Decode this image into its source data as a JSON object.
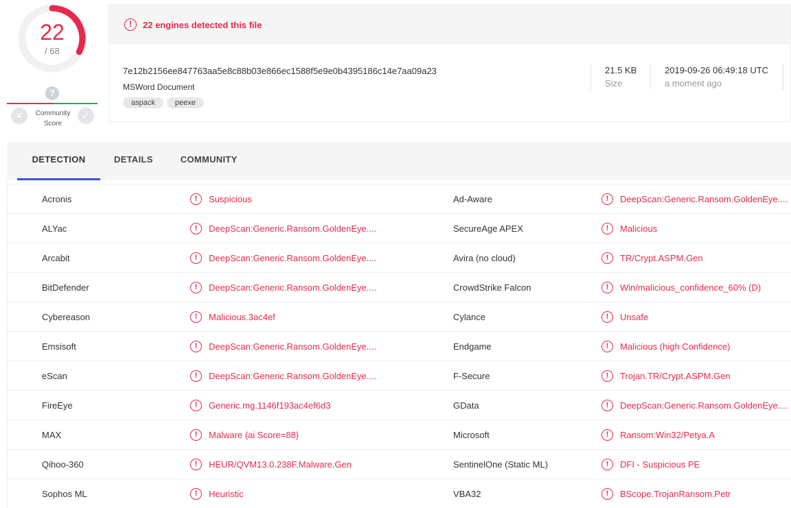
{
  "score": {
    "detected": "22",
    "total": "/ 68",
    "fraction": 0.3235,
    "community_label_1": "Community",
    "community_label_2": "Score",
    "question_glyph": "?",
    "icons": [
      "question-icon",
      "thumbs-down-x-icon",
      "thumbs-up-check-icon"
    ]
  },
  "header": {
    "alert_text": "22 engines detected this file",
    "hash": "7e12b2156ee847763aa5e8c88b03e866ec1588f5e9e0b4395186c14e7aa09a23",
    "file_type": "MSWord Document",
    "tags": [
      "aspack",
      "peexe"
    ],
    "size_value": "21.5 KB",
    "size_label": "Size",
    "date_value": "2019-09-26 06:49:18 UTC",
    "date_label": "a moment ago"
  },
  "tabs": [
    {
      "label": "DETECTION",
      "active": true
    },
    {
      "label": "DETAILS",
      "active": false
    },
    {
      "label": "COMMUNITY",
      "active": false
    }
  ],
  "detections": [
    {
      "left_engine": "Acronis",
      "left_result": "Suspicious",
      "right_engine": "Ad-Aware",
      "right_result": "DeepScan:Generic.Ransom.GoldenEye...."
    },
    {
      "left_engine": "ALYac",
      "left_result": "DeepScan:Generic.Ransom.GoldenEye....",
      "right_engine": "SecureAge APEX",
      "right_result": "Malicious"
    },
    {
      "left_engine": "Arcabit",
      "left_result": "DeepScan:Generic.Ransom.GoldenEye....",
      "right_engine": "Avira (no cloud)",
      "right_result": "TR/Crypt.ASPM.Gen"
    },
    {
      "left_engine": "BitDefender",
      "left_result": "DeepScan:Generic.Ransom.GoldenEye....",
      "right_engine": "CrowdStrike Falcon",
      "right_result": "Win/malicious_confidence_60% (D)"
    },
    {
      "left_engine": "Cybereason",
      "left_result": "Malicious.3ac4ef",
      "right_engine": "Cylance",
      "right_result": "Unsafe"
    },
    {
      "left_engine": "Emsisoft",
      "left_result": "DeepScan:Generic.Ransom.GoldenEye....",
      "right_engine": "Endgame",
      "right_result": "Malicious (high Confidence)"
    },
    {
      "left_engine": "eScan",
      "left_result": "DeepScan:Generic.Ransom.GoldenEye....",
      "right_engine": "F-Secure",
      "right_result": "Trojan.TR/Crypt.ASPM.Gen"
    },
    {
      "left_engine": "FireEye",
      "left_result": "Generic.mg.1146f193ac4ef6d3",
      "right_engine": "GData",
      "right_result": "DeepScan:Generic.Ransom.GoldenEye...."
    },
    {
      "left_engine": "MAX",
      "left_result": "Malware (ai Score=88)",
      "right_engine": "Microsoft",
      "right_result": "Ransom:Win32/Petya.A"
    },
    {
      "left_engine": "Qihoo-360",
      "left_result": "HEUR/QVM13.0.238F.Malware.Gen",
      "right_engine": "SentinelOne (Static ML)",
      "right_result": "DFI - Suspicious PE"
    },
    {
      "left_engine": "Sophos ML",
      "left_result": "Heuristic",
      "right_engine": "VBA32",
      "right_result": "BScope.TrojanRansom.Petr"
    }
  ],
  "colors": {
    "malicious": "#e8294c",
    "accent_tab": "#3b53d6",
    "community_positive": "#2ea44f"
  }
}
